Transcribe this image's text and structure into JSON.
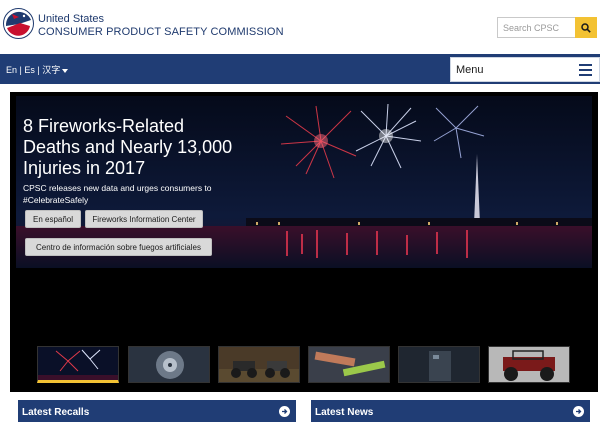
{
  "header": {
    "agency_line1": "United States",
    "agency_line2": "CONSUMER PRODUCT SAFETY COMMISSION",
    "search_placeholder": "Search CPSC",
    "search_icon": "search-icon"
  },
  "nav": {
    "languages": [
      "En",
      "Es",
      "汉字"
    ],
    "separator": "|",
    "menu_label": "Menu",
    "menu_icon": "hamburger-icon"
  },
  "carousel": {
    "headline": "8 Fireworks-Related Deaths and Nearly 13,000 Injuries in 2017",
    "subtext": "CPSC releases new data and urges consumers to #CelebrateSafely",
    "buttons": {
      "espanol": "En español",
      "info_center": "Fireworks Information Center",
      "centro": "Centro de información sobre fuegos artificiales"
    },
    "thumbnails": [
      "fireworks-thumb",
      "hurricane-thumb",
      "atv-thumb",
      "tools-thumb",
      "appliance-thumb",
      "off-road-vehicle-thumb"
    ],
    "active_thumb": 0
  },
  "panels": {
    "recalls_title": "Latest Recalls",
    "news_title": "Latest News"
  },
  "colors": {
    "navy": "#203d75",
    "accent_yellow": "#f3c233",
    "carousel_bg": "#000000"
  }
}
